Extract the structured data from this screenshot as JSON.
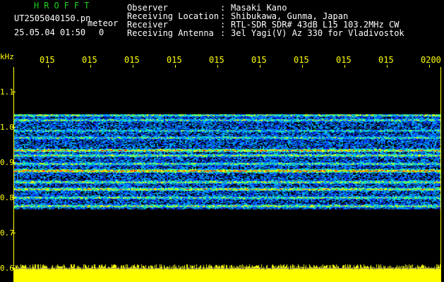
{
  "header": {
    "brand": "HROFFT",
    "filename": "UT2505040150.pn",
    "mode": "meteor",
    "timestamp": "25.05.04 01:50",
    "count": "0",
    "fields": [
      {
        "label": "Observer",
        "value": "Masaki Kano"
      },
      {
        "label": "Receiving Location",
        "value": "Shibukawa, Gunma, Japan"
      },
      {
        "label": "Receiver",
        "value": "RTL-SDR SDR# 43dB L15 103.2MHz CW"
      },
      {
        "label": "Receiving Antenna",
        "value": "3el Yagi(V) Az 330 for Vladivostok"
      }
    ]
  },
  "axis": {
    "unit": "kHz",
    "y_ticks": [
      "1.1",
      "1.0",
      "0.9",
      "0.8",
      "0.7",
      "0.6"
    ],
    "x_ticks": [
      "015",
      "015",
      "015",
      "015",
      "015",
      "015",
      "015",
      "015",
      "015",
      "0200"
    ]
  },
  "colors": {
    "text": "#ffffff",
    "brand": "#1fd21f",
    "axis": "#ffff00",
    "noise_floor": "#ffff00"
  }
}
